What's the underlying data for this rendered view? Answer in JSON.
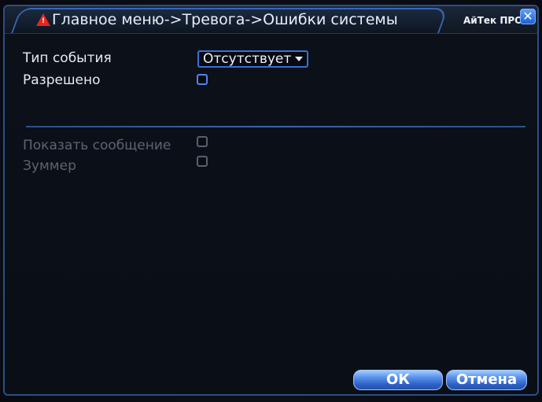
{
  "window": {
    "breadcrumb": "Главное меню->Тревога->Ошибки системы",
    "brand": "АйТек ПРО",
    "close_glyph": "✕",
    "icon_glyph": "!"
  },
  "form": {
    "event_type_label": "Тип события",
    "event_type_value": "Отсутствует",
    "enabled_label": "Разрешено",
    "enabled_checked": false,
    "show_message_label": "Показать сообщение",
    "show_message_checked": false,
    "buzzer_label": "Зуммер",
    "buzzer_checked": false
  },
  "buttons": {
    "ok_label": "ОК",
    "cancel_label": "Отмена"
  },
  "colors": {
    "accent": "#3b6fd8",
    "warning": "#e4261f",
    "disabled_text": "#5d6470"
  },
  "icons": [
    "warning-icon",
    "close-icon",
    "chevron-down-icon"
  ]
}
